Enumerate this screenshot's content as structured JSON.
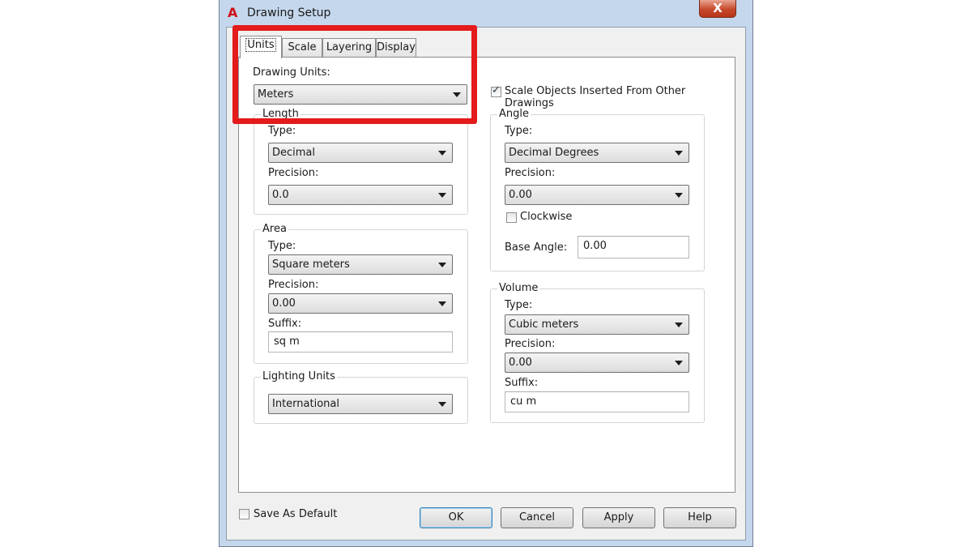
{
  "window": {
    "title": "Drawing Setup",
    "close_label": "X",
    "app_icon": "A"
  },
  "tabs": [
    {
      "label": "Units",
      "active": true
    },
    {
      "label": "Scale",
      "active": false
    },
    {
      "label": "Layering",
      "active": false
    },
    {
      "label": "Display",
      "active": false
    }
  ],
  "drawing_units": {
    "label": "Drawing Units:",
    "value": "Meters"
  },
  "scale_objects": {
    "label": "Scale Objects Inserted From Other Drawings",
    "checked": true
  },
  "length": {
    "title": "Length",
    "type_label": "Type:",
    "type_value": "Decimal",
    "precision_label": "Precision:",
    "precision_value": "0.0"
  },
  "area": {
    "title": "Area",
    "type_label": "Type:",
    "type_value": "Square meters",
    "precision_label": "Precision:",
    "precision_value": "0.00",
    "suffix_label": "Suffix:",
    "suffix_value": "sq m"
  },
  "lighting": {
    "title": "Lighting Units",
    "value": "International"
  },
  "angle": {
    "title": "Angle",
    "type_label": "Type:",
    "type_value": "Decimal Degrees",
    "precision_label": "Precision:",
    "precision_value": "0.00",
    "clockwise_label": "Clockwise",
    "clockwise_checked": false,
    "base_angle_label": "Base Angle:",
    "base_angle_value": "0.00"
  },
  "volume": {
    "title": "Volume",
    "type_label": "Type:",
    "type_value": "Cubic meters",
    "precision_label": "Precision:",
    "precision_value": "0.00",
    "suffix_label": "Suffix:",
    "suffix_value": "cu m"
  },
  "footer": {
    "save_default_label": "Save As Default",
    "save_default_checked": false,
    "ok_label": "OK",
    "cancel_label": "Cancel",
    "apply_label": "Apply",
    "help_label": "Help"
  },
  "colors": {
    "highlight": "#e41b1b",
    "app_icon": "#d0121a",
    "close_button": "#c7492c"
  }
}
